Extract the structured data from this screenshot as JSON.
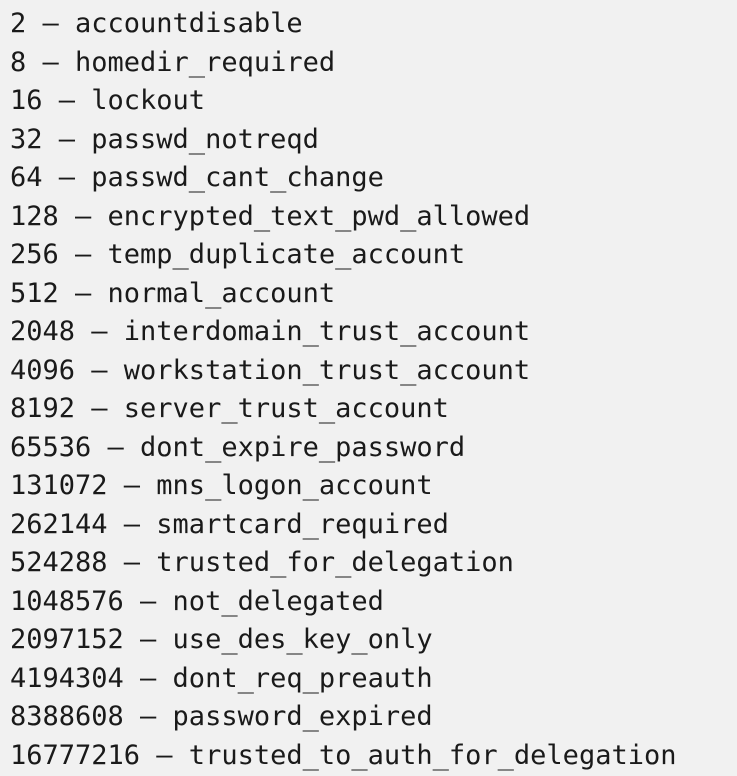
{
  "lines": [
    "2 – accountdisable",
    "8 – homedir_required",
    "16 – lockout",
    "32 – passwd_notreqd",
    "64 – passwd_cant_change",
    "128 – encrypted_text_pwd_allowed",
    "256 – temp_duplicate_account",
    "512 – normal_account",
    "2048 – interdomain_trust_account",
    "4096 – workstation_trust_account",
    "8192 – server_trust_account",
    "65536 – dont_expire_password",
    "131072 – mns_logon_account",
    "262144 – smartcard_required",
    "524288 – trusted_for_delegation",
    "1048576 – not_delegated",
    "2097152 – use_des_key_only",
    "4194304 – dont_req_preauth",
    "8388608 – password_expired",
    "16777216 – trusted_to_auth_for_delegation"
  ]
}
